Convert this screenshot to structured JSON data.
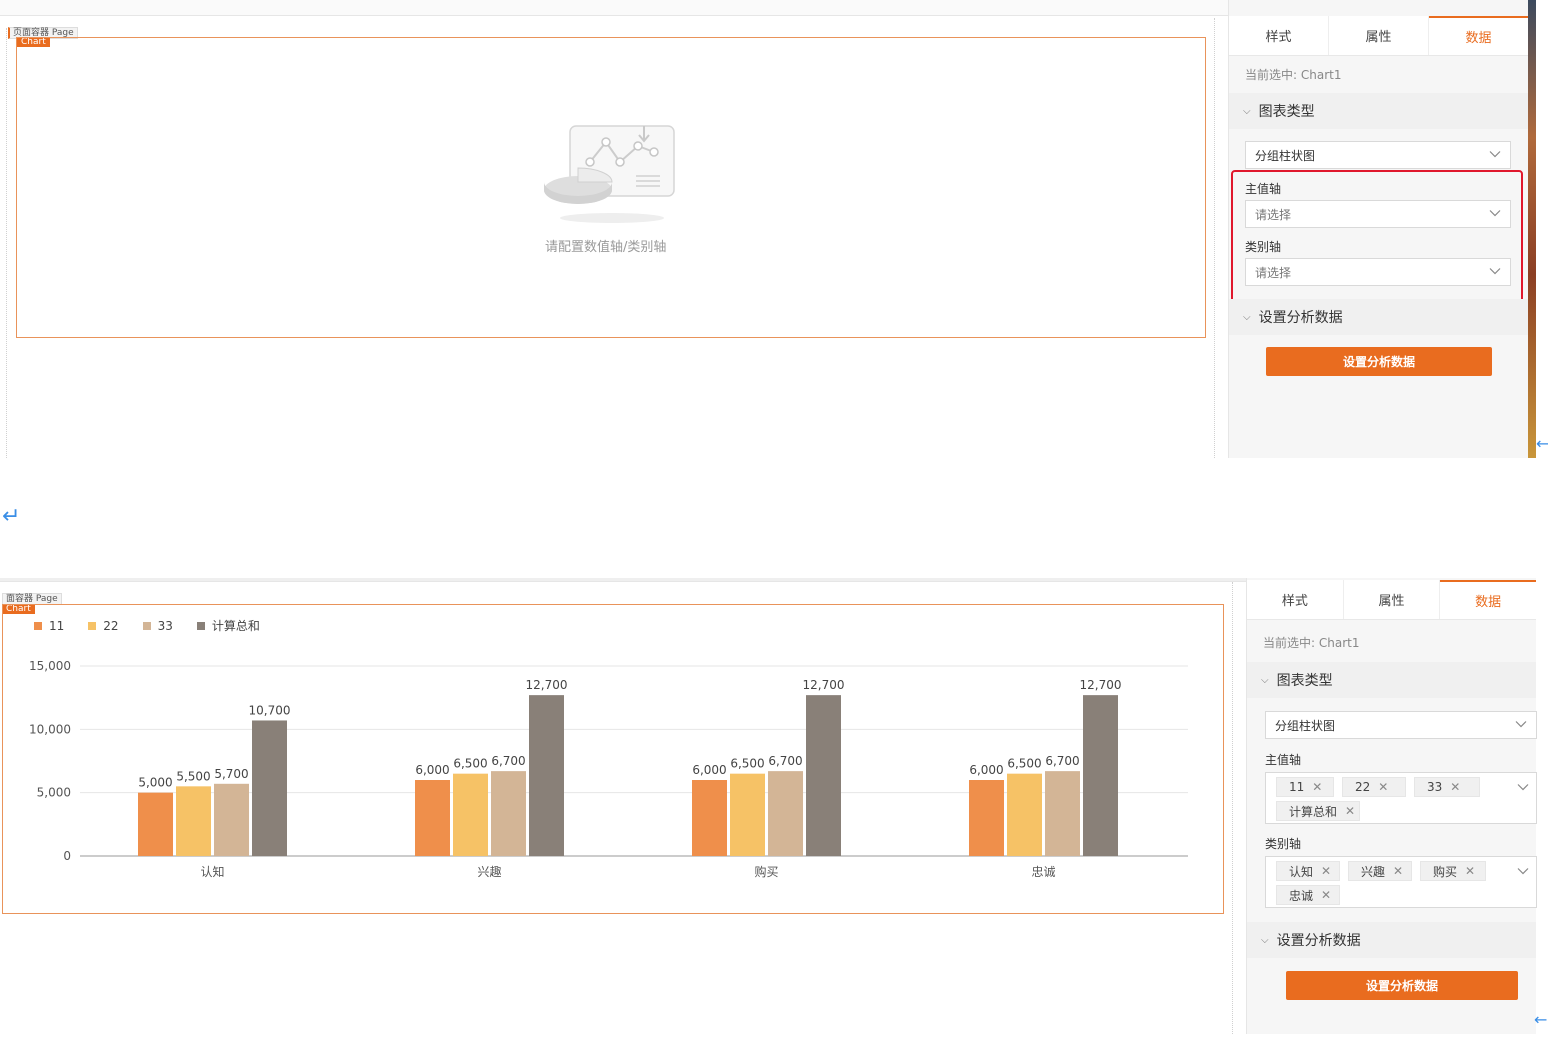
{
  "shot1": {
    "page_label": "页面容器 Page",
    "chart_label": "Chart",
    "empty_message": "请配置数值轴/类别轴",
    "panel": {
      "tabs": [
        "样式",
        "属性",
        "数据"
      ],
      "active_tab": "数据",
      "selected": "当前选中: Chart1",
      "chart_type_title": "图表类型",
      "chart_type_value": "分组柱状图",
      "value_axis_label": "主值轴",
      "value_axis_placeholder": "请选择",
      "category_axis_label": "类别轴",
      "category_axis_placeholder": "请选择",
      "analysis_title": "设置分析数据",
      "analysis_button": "设置分析数据"
    }
  },
  "shot2": {
    "page_label": "面容器 Page",
    "chart_label": "Chart",
    "panel": {
      "tabs": [
        "样式",
        "属性",
        "数据"
      ],
      "active_tab": "数据",
      "selected": "当前选中: Chart1",
      "chart_type_title": "图表类型",
      "chart_type_value": "分组柱状图",
      "value_axis_label": "主值轴",
      "value_axis_chips": [
        "11",
        "22",
        "33",
        "计算总和"
      ],
      "category_axis_label": "类别轴",
      "category_axis_chips": [
        "认知",
        "兴趣",
        "购买",
        "忠诚"
      ],
      "analysis_title": "设置分析数据",
      "analysis_button": "设置分析数据"
    }
  },
  "colors": {
    "accent": "#e96c1f",
    "highlight": "#e0182d",
    "arrow": "#3a8ee6"
  },
  "icons": {
    "tab_dropdown": "chevron-down-icon",
    "chip_remove": "close-icon",
    "return": "enter-arrow-icon",
    "side": "back-arrow-icon"
  },
  "chart_data": {
    "type": "bar",
    "categories": [
      "认知",
      "兴趣",
      "购买",
      "忠诚"
    ],
    "series": [
      {
        "name": "11",
        "color": "#ef8f4b",
        "values": [
          5000,
          6000,
          6000,
          6000
        ],
        "labels": [
          "5,000",
          "6,000",
          "6,000",
          "6,000"
        ]
      },
      {
        "name": "22",
        "color": "#f6c266",
        "values": [
          5500,
          6500,
          6500,
          6500
        ],
        "labels": [
          "5,500",
          "6,500",
          "6,500",
          "6,500"
        ]
      },
      {
        "name": "33",
        "color": "#d3b596",
        "values": [
          5700,
          6700,
          6700,
          6700
        ],
        "labels": [
          "5,700",
          "6,700",
          "6,700",
          "6,700"
        ]
      },
      {
        "name": "计算总和",
        "color": "#898078",
        "values": [
          10700,
          12700,
          12700,
          12700
        ],
        "labels": [
          "10,700",
          "12,700",
          "12,700",
          "12,700"
        ]
      }
    ],
    "yticks": [
      "0",
      "5,000",
      "10,000",
      "15,000"
    ],
    "ytick_values": [
      0,
      5000,
      10000,
      15000
    ],
    "ylim": [
      0,
      15000
    ],
    "grid": true,
    "legend_position": "top-left"
  }
}
